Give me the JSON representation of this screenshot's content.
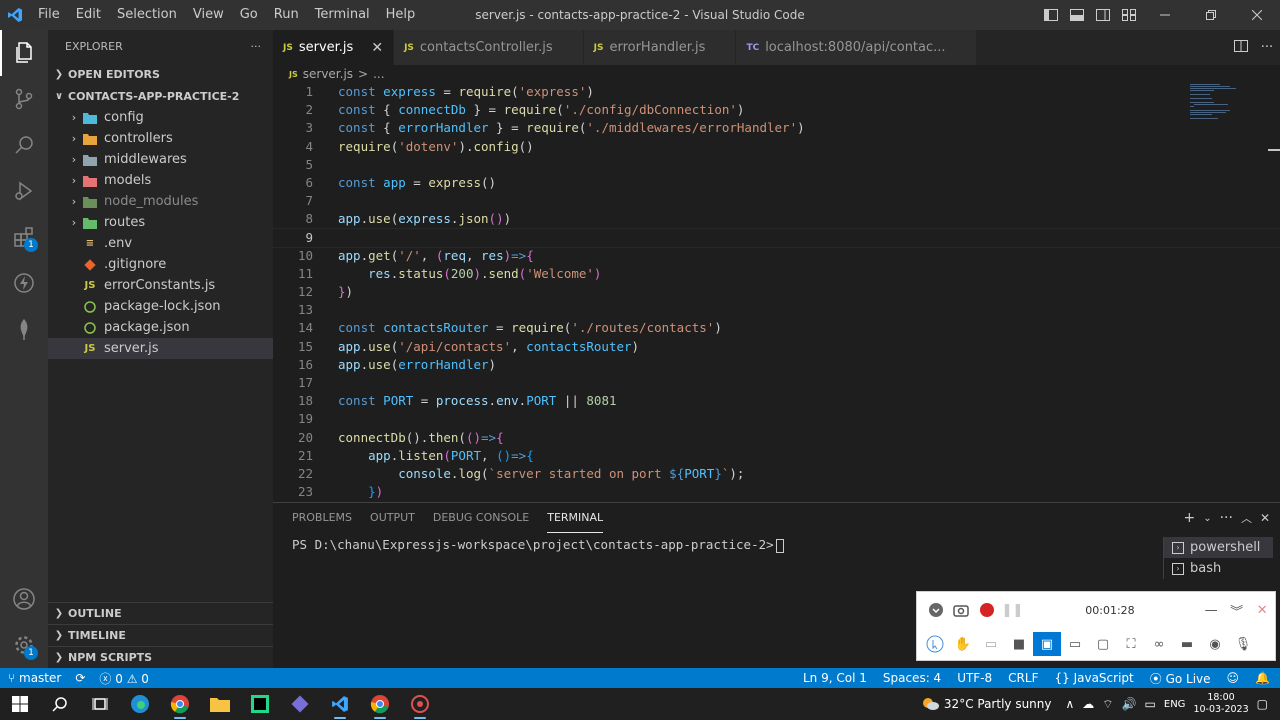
{
  "titlebar": {
    "menu": [
      "File",
      "Edit",
      "Selection",
      "View",
      "Go",
      "Run",
      "Terminal",
      "Help"
    ],
    "window_title": "server.js - contacts-app-practice-2 - Visual Studio Code"
  },
  "activitybar": {
    "extensions_badge": "1",
    "settings_badge": "1"
  },
  "sidebar": {
    "header": "EXPLORER",
    "more": "···",
    "open_editors": "OPEN EDITORS",
    "project": "CONTACTS-APP-PRACTICE-2",
    "tree": [
      {
        "label": "config",
        "type": "folder"
      },
      {
        "label": "controllers",
        "type": "folder"
      },
      {
        "label": "middlewares",
        "type": "folder"
      },
      {
        "label": "models",
        "type": "folder"
      },
      {
        "label": "node_modules",
        "type": "folder"
      },
      {
        "label": "routes",
        "type": "folder"
      },
      {
        "label": ".env",
        "type": "file"
      },
      {
        "label": ".gitignore",
        "type": "file"
      },
      {
        "label": "errorConstants.js",
        "type": "file"
      },
      {
        "label": "package-lock.json",
        "type": "file"
      },
      {
        "label": "package.json",
        "type": "file"
      },
      {
        "label": "server.js",
        "type": "file"
      }
    ],
    "outline": "OUTLINE",
    "timeline": "TIMELINE",
    "npm_scripts": "NPM SCRIPTS"
  },
  "tabs": [
    {
      "icon": "JS",
      "label": "server.js"
    },
    {
      "icon": "JS",
      "label": "contactsController.js"
    },
    {
      "icon": "JS",
      "label": "errorHandler.js"
    },
    {
      "icon": "TC",
      "label": "localhost:8080/api/contac..."
    }
  ],
  "breadcrumb": {
    "icon": "JS",
    "file": "server.js",
    "sep": ">",
    "more": "..."
  },
  "editor": {
    "line_numbers": [
      "1",
      "2",
      "3",
      "4",
      "5",
      "6",
      "7",
      "8",
      "9",
      "10",
      "11",
      "12",
      "13",
      "14",
      "15",
      "16",
      "17",
      "18",
      "19",
      "20",
      "21",
      "22",
      "23"
    ]
  },
  "panel": {
    "tabs": [
      "PROBLEMS",
      "OUTPUT",
      "DEBUG CONSOLE",
      "TERMINAL"
    ],
    "terminal_prompt": "PS D:\\chanu\\Expressjs-workspace\\project\\contacts-app-practice-2>",
    "terminals": [
      "powershell",
      "bash"
    ]
  },
  "recorder": {
    "time": "00:01:28"
  },
  "statusbar": {
    "branch": "master",
    "errors": "0",
    "warnings": "0",
    "position": "Ln 9, Col 1",
    "spaces": "Spaces: 4",
    "encoding": "UTF-8",
    "eol": "CRLF",
    "language": "JavaScript",
    "golive": "Go Live"
  },
  "taskbar": {
    "weather": "32°C  Partly sunny",
    "lang": "ENG",
    "time": "18:00",
    "date": "10-03-2023"
  },
  "colors": {
    "accent": "#007acc",
    "js_icon": "#cbcb41"
  }
}
